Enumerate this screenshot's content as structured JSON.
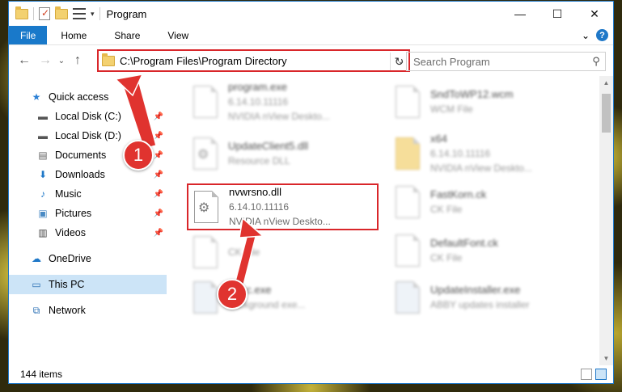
{
  "window": {
    "title": "Program",
    "controls": {
      "minimize": "—",
      "maximize": "☐",
      "close": "✕"
    }
  },
  "ribbon": {
    "tabs": [
      "File",
      "Home",
      "Share",
      "View"
    ],
    "expand_glyph": "⌄",
    "help_glyph": "?"
  },
  "address": {
    "path": "C:\\Program Files\\Program Directory",
    "dropdown_glyph": "⌄",
    "refresh_glyph": "↻"
  },
  "search": {
    "placeholder": "Search Program",
    "icon": "search-icon"
  },
  "nav_buttons": {
    "back": "←",
    "forward": "→",
    "recent": "⌄",
    "up": "↑"
  },
  "sidebar": {
    "items": [
      {
        "label": "Quick access",
        "icon": "star-icon",
        "pinned": false
      },
      {
        "label": "Local Disk (C:)",
        "icon": "drive-icon",
        "pinned": true
      },
      {
        "label": "Local Disk (D:)",
        "icon": "drive-icon",
        "pinned": true
      },
      {
        "label": "Documents",
        "icon": "documents-icon",
        "pinned": true
      },
      {
        "label": "Downloads",
        "icon": "download-icon",
        "pinned": true
      },
      {
        "label": "Music",
        "icon": "music-icon",
        "pinned": true
      },
      {
        "label": "Pictures",
        "icon": "pictures-icon",
        "pinned": true
      },
      {
        "label": "Videos",
        "icon": "videos-icon",
        "pinned": true
      },
      {
        "label": "OneDrive",
        "icon": "cloud-icon",
        "pinned": false
      },
      {
        "label": "This PC",
        "icon": "computer-icon",
        "pinned": false,
        "selected": true
      },
      {
        "label": "Network",
        "icon": "network-icon",
        "pinned": false
      }
    ]
  },
  "files": [
    {
      "name": "program.exe",
      "line2": "6.14.10.11116",
      "line3": "NVIDIA nView Deskto..."
    },
    {
      "name": "UpdateClient5.dll",
      "line2": "Resource DLL",
      "line3": ""
    },
    {
      "name": "nvwrsno.dll",
      "line2": "6.14.10.11116",
      "line3": "NVIDIA nView Deskto...",
      "highlighted": true
    },
    {
      "name": "",
      "line2": "CK File",
      "line3": ""
    },
    {
      "name": "Exec.exe",
      "line2": "background exe...",
      "line3": ""
    },
    {
      "name": "SndToWP12.wcm",
      "line2": "WCM File",
      "line3": ""
    },
    {
      "name": "x64",
      "line2": "6.14.10.11116",
      "line3": "NVIDIA nView Deskto..."
    },
    {
      "name": "FastKorn.ck",
      "line2": "CK File",
      "line3": ""
    },
    {
      "name": "DefaultFont.ck",
      "line2": "CK File",
      "line3": ""
    },
    {
      "name": "UpdateInstaller.exe",
      "line2": "ABBY updates installer",
      "line3": ""
    }
  ],
  "status": {
    "item_count": "144 items"
  },
  "callouts": [
    "1",
    "2"
  ]
}
